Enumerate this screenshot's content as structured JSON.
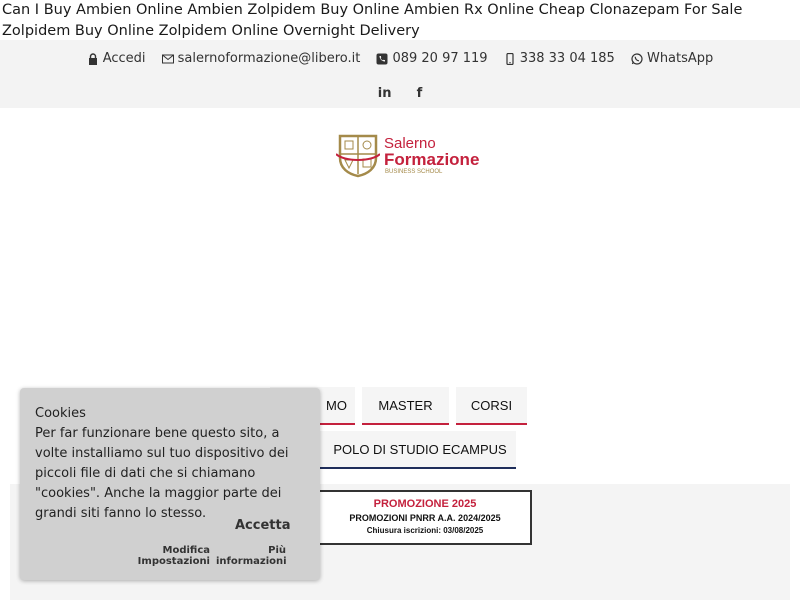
{
  "heading": "Can I Buy Ambien Online Ambien Zolpidem Buy Online Ambien Rx Online Cheap Clonazepam For Sale Zolpidem Buy Online Zolpidem Online Overnight Delivery",
  "topbar": {
    "login_label": "Accedi",
    "email": "salernoformazione@libero.it",
    "phone": "089 20 97 119",
    "mobile": "338 33 04 185",
    "whatsapp_label": "WhatsApp",
    "linkedin_label": "in",
    "facebook_label": "f"
  },
  "logo": {
    "line1": "Salerno",
    "line2": "Formazione",
    "line3": "BUSINESS SCHOOL"
  },
  "nav": {
    "item_partial": "MO",
    "master": "MASTER",
    "corsi": "CORSI",
    "polo": "POLO DI STUDIO ECAMPUS"
  },
  "promo": {
    "title": "PROMOZIONE 2025",
    "subtitle": "PROMOZIONI PNRR A.A. 2024/2025",
    "deadline": "Chiusura iscrizioni: 03/08/2025"
  },
  "cookie": {
    "title": "Cookies",
    "body": "Per far funzionare bene questo sito, a volte installiamo sul tuo dispositivo dei piccoli file di dati che si chiamano \"cookies\". Anche la maggior parte dei grandi siti fanno lo stesso.",
    "accept": "Accetta",
    "modify_line1": "Modifica",
    "modify_line2": "Impostazioni",
    "more_line1": "Più",
    "more_line2": "informazioni"
  },
  "colors": {
    "accent": "#c4213d",
    "nav_underline_red": "#c4213d",
    "nav_underline_blue": "#1e2d5a"
  }
}
